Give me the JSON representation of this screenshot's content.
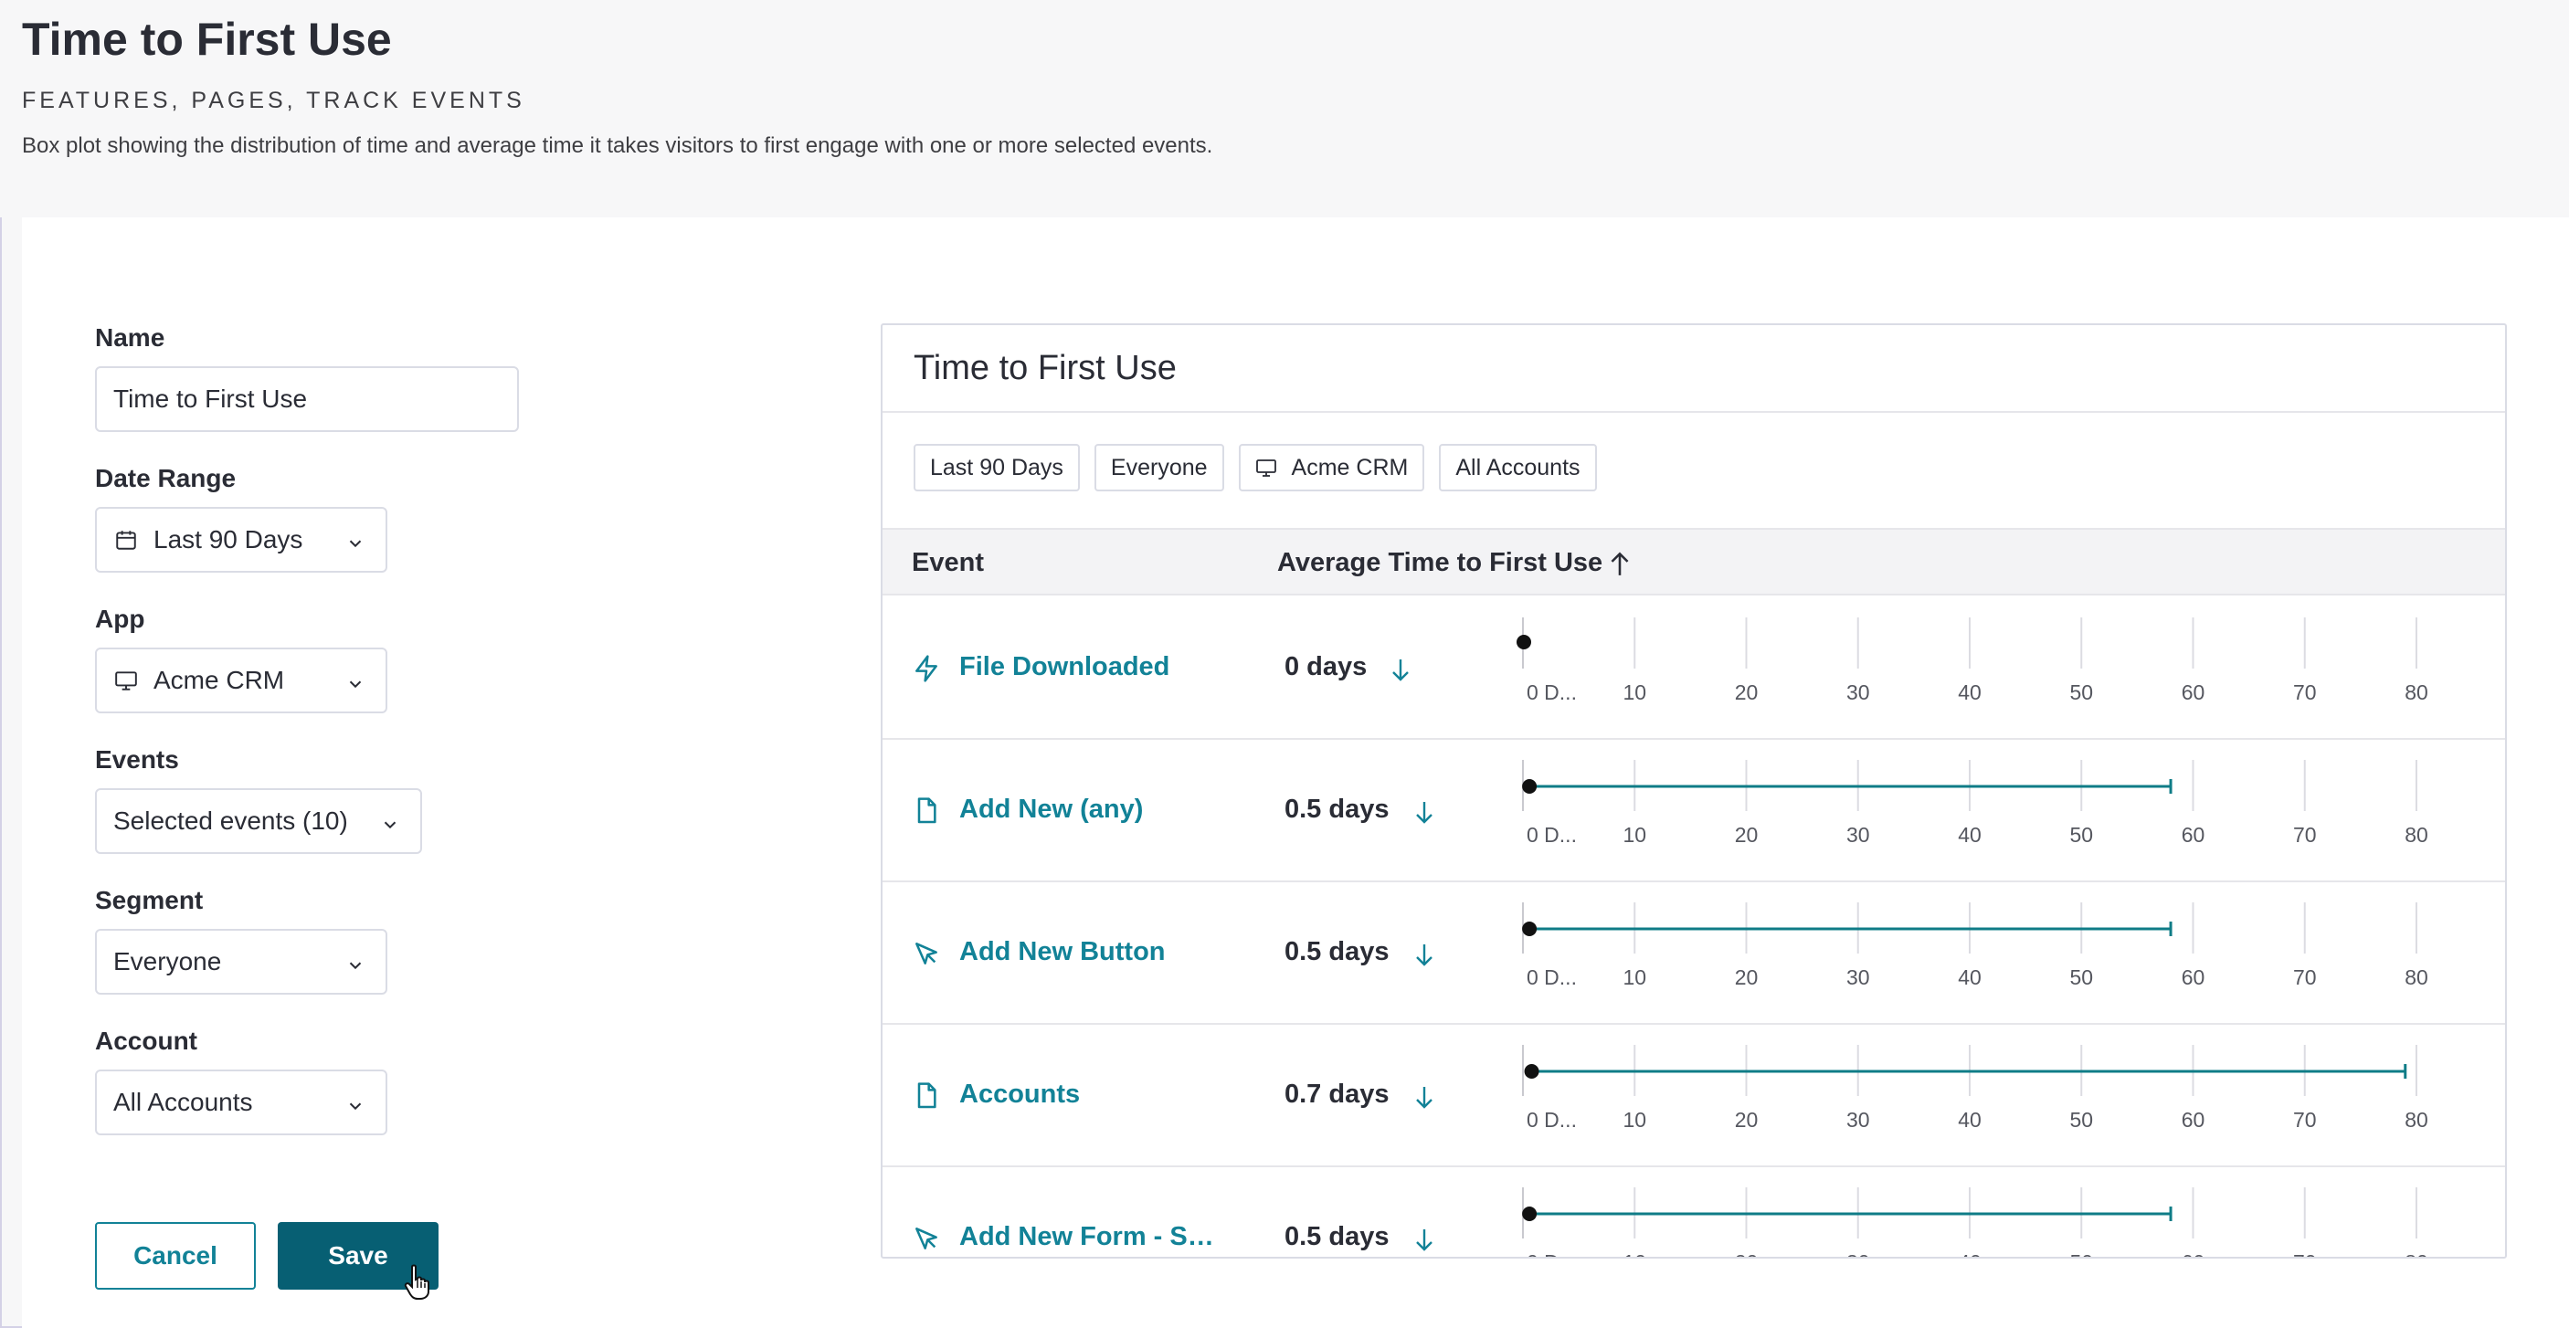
{
  "page": {
    "title": "Time to First Use",
    "subtitle": "FEATURES, PAGES, TRACK EVENTS",
    "description": "Box plot showing the distribution of time and average time it takes visitors to first engage with one or more selected events."
  },
  "form": {
    "name_label": "Name",
    "name_value": "Time to First Use",
    "date_range_label": "Date Range",
    "date_range_value": "Last 90 Days",
    "app_label": "App",
    "app_value": "Acme CRM",
    "events_label": "Events",
    "events_value": "Selected events (10)",
    "segment_label": "Segment",
    "segment_value": "Everyone",
    "account_label": "Account",
    "account_value": "All Accounts",
    "cancel_label": "Cancel",
    "save_label": "Save"
  },
  "panel": {
    "title": "Time to First Use",
    "chips": [
      "Last 90 Days",
      "Everyone",
      "Acme CRM",
      "All Accounts"
    ],
    "col_event": "Event",
    "col_avg": "Average Time to First Use",
    "axis_ticks": [
      "0 D...",
      "10",
      "20",
      "30",
      "40",
      "50",
      "60",
      "70",
      "80"
    ],
    "rows": [
      {
        "event": "File Downloaded",
        "icon": "lightning-icon",
        "avg": "0 days"
      },
      {
        "event": "Add New (any)",
        "icon": "page-icon",
        "avg": "0.5 days"
      },
      {
        "event": "Add New Button",
        "icon": "cursor-icon",
        "avg": "0.5 days"
      },
      {
        "event": "Accounts",
        "icon": "page-icon",
        "avg": "0.7 days"
      },
      {
        "event": "Add New Form - Su...",
        "icon": "cursor-icon",
        "avg": "0.5 days"
      }
    ]
  },
  "chart_data": {
    "type": "box",
    "xlim": [
      0,
      80
    ],
    "x_ticks": [
      "0 D...",
      "10",
      "20",
      "30",
      "40",
      "50",
      "60",
      "70",
      "80"
    ],
    "series": [
      {
        "name": "File Downloaded",
        "avg": 0,
        "min": 0,
        "max": 0
      },
      {
        "name": "Add New (any)",
        "avg": 0.5,
        "min": 0,
        "max": 58
      },
      {
        "name": "Add New Button",
        "avg": 0.5,
        "min": 0,
        "max": 58
      },
      {
        "name": "Accounts",
        "avg": 0.7,
        "min": 0,
        "max": 79
      },
      {
        "name": "Add New Form - Su...",
        "avg": 0.5,
        "min": 0,
        "max": 58
      }
    ]
  },
  "colors": {
    "accent": "#128297",
    "primary_button": "#075f73",
    "plot_line": "#0f7c87"
  }
}
